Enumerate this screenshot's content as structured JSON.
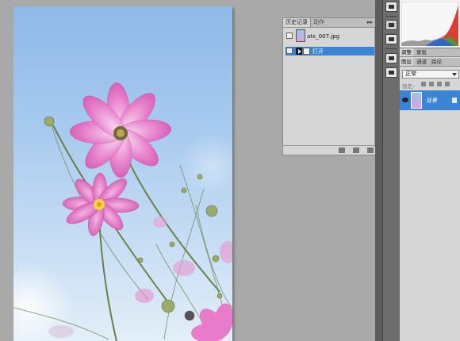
{
  "history_panel": {
    "tabs": [
      "历史记录",
      "动作"
    ],
    "menu_glyph": "▸▸ ≡",
    "snapshot_label": "atx_007.jpg",
    "steps": [
      "打开"
    ]
  },
  "right_panels": {
    "adjust_tabs": [
      "调整",
      "蒙版"
    ],
    "layer_tabs": [
      "图层",
      "通道",
      "路径"
    ],
    "blend_mode": "正常",
    "lock_label": "锁定:",
    "layers": [
      {
        "name": "背景"
      }
    ]
  },
  "colors": {
    "selection_blue": "#3a84d4",
    "panel_gray": "#d6d6d6",
    "workspace_gray": "#a9a9a9"
  },
  "icons": {
    "history_step_icon": "open-document-icon",
    "history_marker_icon": "history-brush-icon",
    "layer_visibility_icon": "eye-icon",
    "layer_lock_icon": "lock-icon"
  }
}
